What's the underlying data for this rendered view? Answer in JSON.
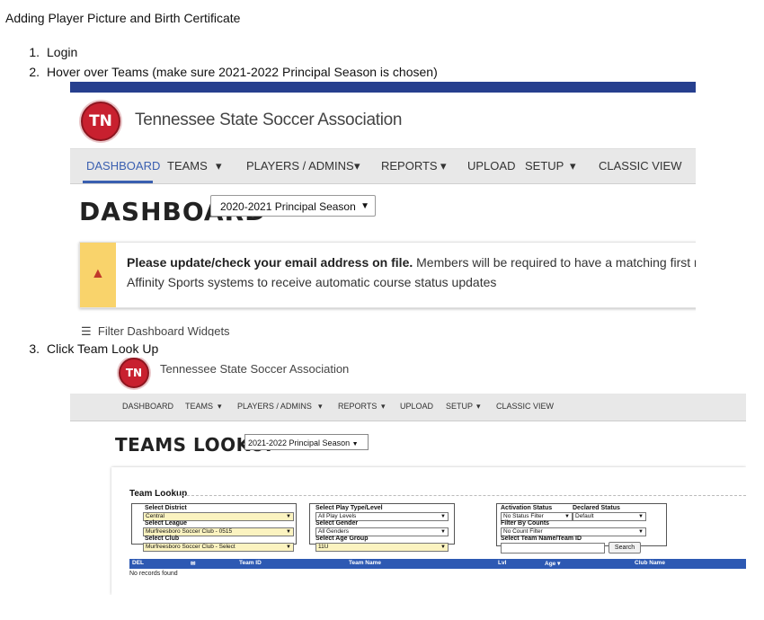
{
  "doc": {
    "title": "Adding Player Picture and Birth Certificate",
    "steps": [
      {
        "num": "1.",
        "text": "Login"
      },
      {
        "num": "2.",
        "text": "Hover over Teams (make sure 2021-2022 Principal Season is chosen)"
      },
      {
        "num": "3.",
        "text": "Click Team Look Up"
      }
    ]
  },
  "brand": {
    "logo_text": "TN",
    "name": "Tennessee State Soccer Association",
    "accent": "#263f8e",
    "logo_color": "#c8202f"
  },
  "nav": {
    "dashboard": "DASHBOARD",
    "teams": "TEAMS",
    "players": "PLAYERS / ADMINS",
    "reports": "REPORTS",
    "upload": "UPLOAD",
    "setup": "SETUP",
    "classic": "CLASSIC VIEW",
    "caret": "▾"
  },
  "dashboard": {
    "heading": "DASHBOARD",
    "season": "2020-2021 Principal Season",
    "alert_bold": "Please update/check your email address on file.",
    "alert_rest": " Members will be required to have a matching first r",
    "alert_line2": "Affinity Sports systems to receive automatic course status updates",
    "filter": "Filter Dashboard Widgets"
  },
  "lookup": {
    "heading": "TEAMS LOOKUP",
    "season": "2021-2022 Principal Season",
    "panel_title": "Team Lookup",
    "district_label": "Select District",
    "district_value": "Central",
    "league_label": "Select League",
    "league_value": "Murfreesboro Soccer Club - 0515",
    "club_label": "Select Club",
    "club_value": "Murfreesboro Soccer Club - Select",
    "play_label": "Select Play Type/Level",
    "play_value": "All Play Levels",
    "gender_label": "Select Gender",
    "gender_value": "All Genders",
    "age_label": "Select Age Group",
    "age_value": "11U",
    "activation_label": "Activation Status",
    "activation_value": "No Status Filter",
    "declared_label": "Declared Status",
    "declared_value": "Default",
    "counts_label": "Filter By Counts",
    "counts_value": "No Count Filter",
    "teamname_label": "Select Team Name/Team ID",
    "search_button": "Search",
    "columns": {
      "del": "DEL",
      "mail": "✉",
      "team_id": "Team ID",
      "team_name": "Team Name",
      "lvl": "Lvl",
      "age": "Age ▾",
      "club_name": "Club Name"
    },
    "no_records": "No records found"
  }
}
